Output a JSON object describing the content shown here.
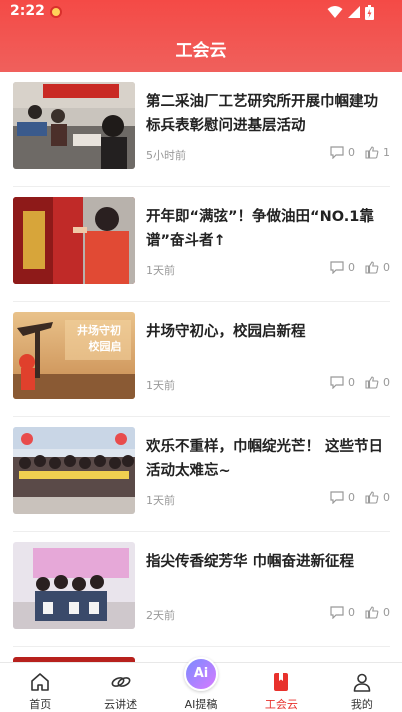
{
  "status_bar": {
    "time": "2:22"
  },
  "header": {
    "title": "工会云"
  },
  "articles": [
    {
      "title": "第二采油厂工艺研究所开展巾帼建功标兵表彰慰问进基层活动",
      "time_ago": "5小时前",
      "comments": "0",
      "likes": "1"
    },
    {
      "title": "开年即“满弦”！争做油田“NO.1靠谱”奋斗者↑",
      "time_ago": "1天前",
      "comments": "0",
      "likes": "0"
    },
    {
      "title": "井场守初心，校园启新程",
      "time_ago": "1天前",
      "comments": "0",
      "likes": "0"
    },
    {
      "title": "欢乐不重样，巾帼绽光芒！ 这些节日活动太难忘~",
      "time_ago": "1天前",
      "comments": "0",
      "likes": "0"
    },
    {
      "title": "指尖传香绽芳华 巾帼奋进新征程",
      "time_ago": "2天前",
      "comments": "0",
      "likes": "0"
    }
  ],
  "thumb_text": {
    "article3_line1": "井场守初",
    "article3_line2": "校园启"
  },
  "tabs": [
    {
      "label": "首页",
      "icon": "home-icon"
    },
    {
      "label": "云讲述",
      "icon": "link-icon"
    },
    {
      "label": "AI提稿",
      "icon": "ai-icon",
      "badge": "Ai"
    },
    {
      "label": "工会云",
      "icon": "bookmark-icon",
      "active": true
    },
    {
      "label": "我的",
      "icon": "user-icon"
    }
  ],
  "colors": {
    "header": "#f44a46",
    "active_tab": "#e8312c"
  }
}
